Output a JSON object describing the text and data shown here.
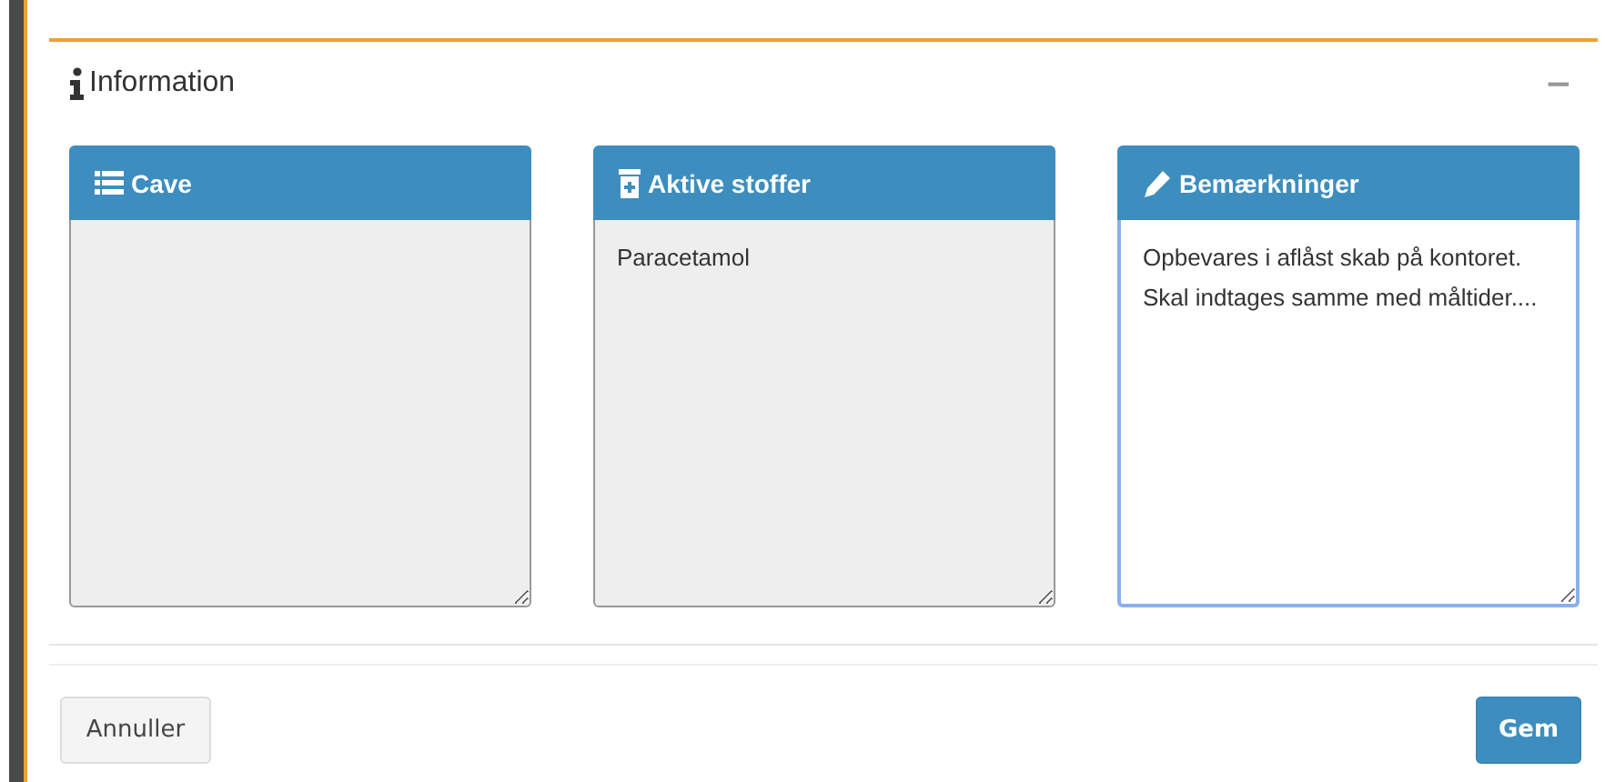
{
  "panel": {
    "title": "Information",
    "collapse": "−"
  },
  "cards": [
    {
      "title": "Cave",
      "disabled": true,
      "focused": false
    },
    {
      "title": "Aktive stoffer",
      "value": "Paracetamol",
      "disabled": true,
      "focused": false
    },
    {
      "title": "Bemærkninger",
      "value": "Opbevares i aflåst skab på kontoret. Skal indtages samme med måltider....",
      "disabled": false,
      "focused": true
    }
  ],
  "buttons": [
    {
      "label": "Annuller",
      "kind": "secondary"
    },
    {
      "label": "Gem",
      "kind": "primary"
    }
  ]
}
